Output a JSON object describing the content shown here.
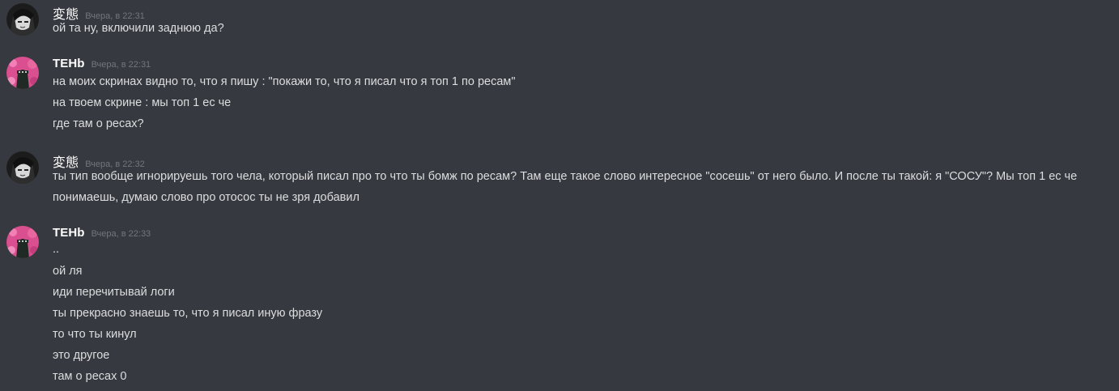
{
  "messages": [
    {
      "author": "変態",
      "timestamp": "Вчера, в 22:31",
      "avatar": "dark-manga-avatar",
      "lines": [
        "ой та ну, включили заднюю да?"
      ]
    },
    {
      "author": "TEHb",
      "timestamp": "Вчера, в 22:31",
      "avatar": "pink-bubble-avatar",
      "lines": [
        "на моих скринах видно то, что я пишу : \"покажи то, что я писал что я топ 1 по ресам\"",
        "на твоем скрине : мы топ 1 ес че",
        "где там о ресах?"
      ]
    },
    {
      "author": "変態",
      "timestamp": "Вчера, в 22:32",
      "avatar": "dark-manga-avatar",
      "lines": [
        "ты тип вообще игнорируешь того чела, который писал про то что ты бомж по ресам? Там еще такое слово интересное \"сосешь\" от него было. И после ты такой: я \"СОСУ\"? Мы топ 1 ес че понимаешь, думаю слово про отосос ты не зря добавил"
      ]
    },
    {
      "author": "TEHb",
      "timestamp": "Вчера, в 22:33",
      "avatar": "pink-bubble-avatar",
      "lines": [
        "..",
        "ой ля",
        "иди перечитывай логи",
        "ты прекрасно знаешь то, что я писал иную фразу",
        "то что ты кинул",
        "это другое",
        "там о ресах 0"
      ]
    }
  ],
  "colors": {
    "background": "#36393f",
    "username": "#ffffff",
    "timestamp": "#72767d",
    "message_text": "#dcddde",
    "pink_avatar": "#d94f8f"
  }
}
